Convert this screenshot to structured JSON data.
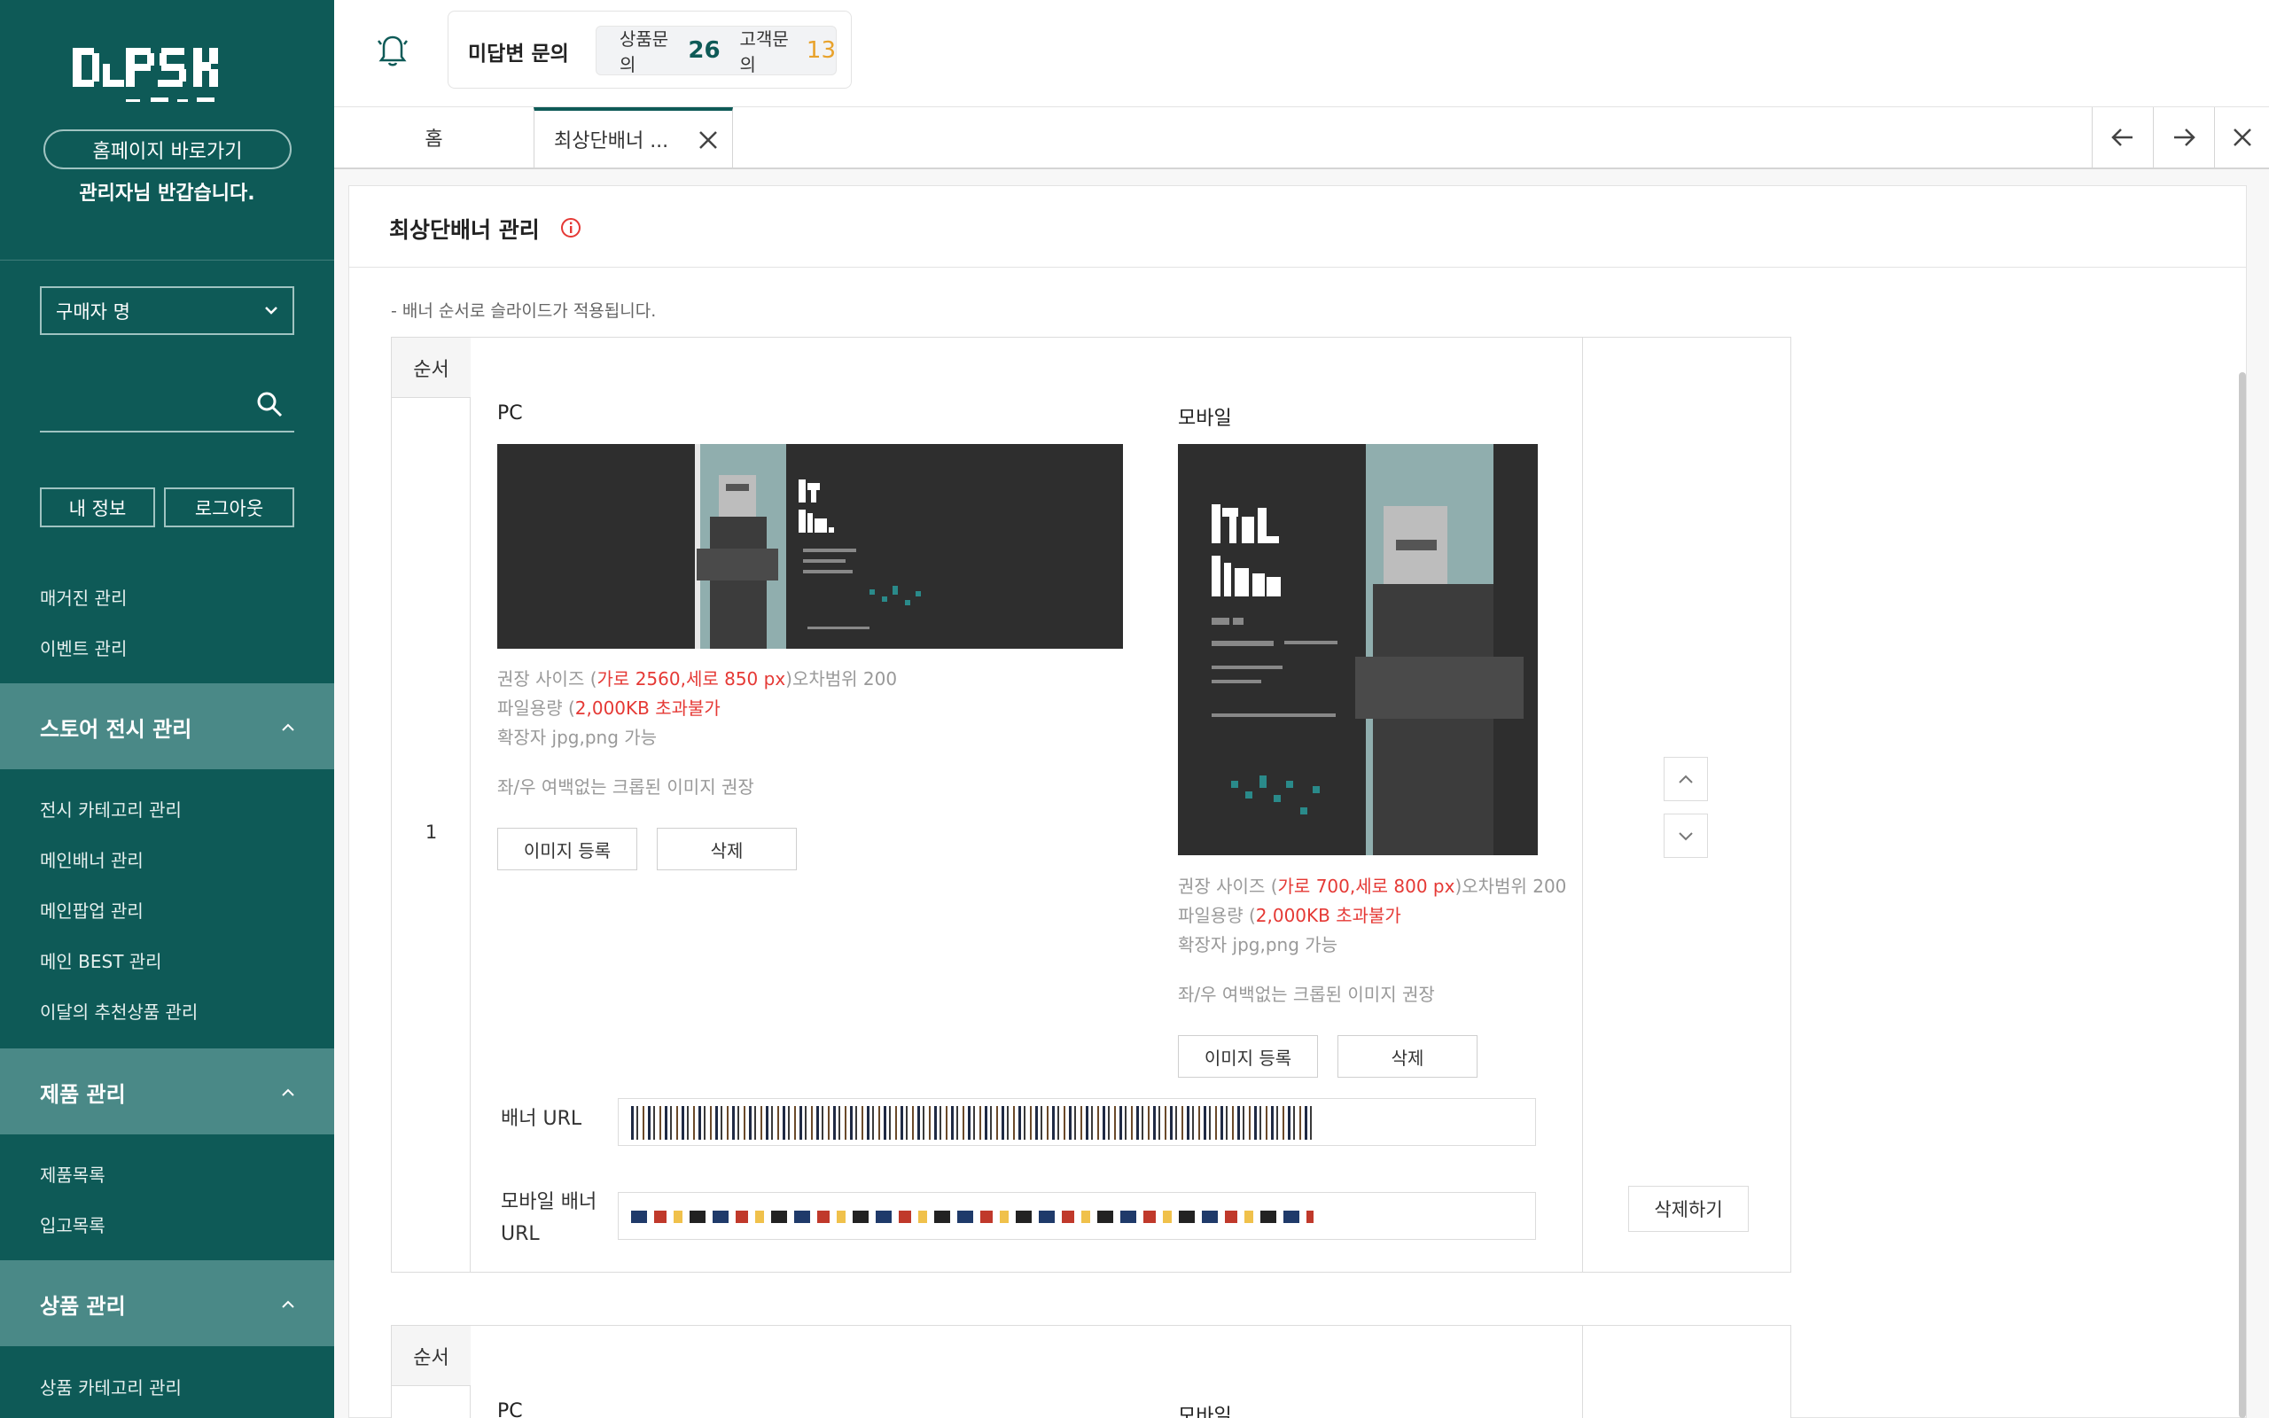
{
  "sidebar": {
    "home_button": "홈페이지 바로가기",
    "welcome": "관리자님 반갑습니다.",
    "buyer_select": "구매자 명",
    "search_placeholder": "",
    "my_info": "내 정보",
    "logout": "로그아웃",
    "top_items": [
      "매거진 관리",
      "이벤트 관리"
    ],
    "sections": [
      {
        "label": "스토어 전시 관리",
        "items": [
          "전시 카테고리 관리",
          "메인배너 관리",
          "메인팝업 관리",
          "메인 BEST 관리",
          "이달의 추천상품 관리"
        ]
      },
      {
        "label": "제품 관리",
        "items": [
          "제품목록",
          "입고목록"
        ]
      },
      {
        "label": "상품 관리",
        "items": [
          "상품 카테고리 관리"
        ]
      }
    ]
  },
  "topbar": {
    "inquiry_title": "미답변 문의",
    "product_inquiry_label": "상품문의",
    "product_inquiry_count": "26",
    "customer_inquiry_label": "고객문의",
    "customer_inquiry_count": "13"
  },
  "tabs": {
    "home": "홈",
    "active": "최상단배너 ..."
  },
  "page": {
    "title": "최상단배너 관리",
    "note": "- 배너 순서로 슬라이드가 적용됩니다.",
    "order_header": "순서",
    "row1_order": "1",
    "pc_label": "PC",
    "mobile_label": "모바일",
    "pc_info": {
      "size_prefix": "권장 사이즈 (",
      "size_value": "가로 2560,세로 850 px",
      "size_suffix": ")오차범위 200",
      "file_prefix": "파일용량 (",
      "file_value": "2,000KB 초과불가",
      "ext": "확장자 jpg,png 가능",
      "crop": "좌/우 여백없는 크롭된 이미지 권장"
    },
    "mobile_info": {
      "size_prefix": "권장 사이즈 (",
      "size_value": "가로 700,세로 800 px",
      "size_suffix": ")오차범위 200",
      "file_prefix": "파일용량 (",
      "file_value": "2,000KB 초과불가",
      "ext": "확장자 jpg,png 가능",
      "crop": "좌/우 여백없는 크롭된 이미지 권장"
    },
    "register_button": "이미지 등록",
    "delete_button": "삭제",
    "banner_url_label": "배너 URL",
    "mobile_url_label_1": "모바일 배너",
    "mobile_url_label_2": "URL",
    "remove_button": "삭제하기"
  },
  "colors": {
    "sidebar_bg": "#0e5a57",
    "section_bg": "#4a8987",
    "accent_green": "#0e5a57",
    "accent_orange": "#e8a22b",
    "warning_red": "#e53935"
  }
}
